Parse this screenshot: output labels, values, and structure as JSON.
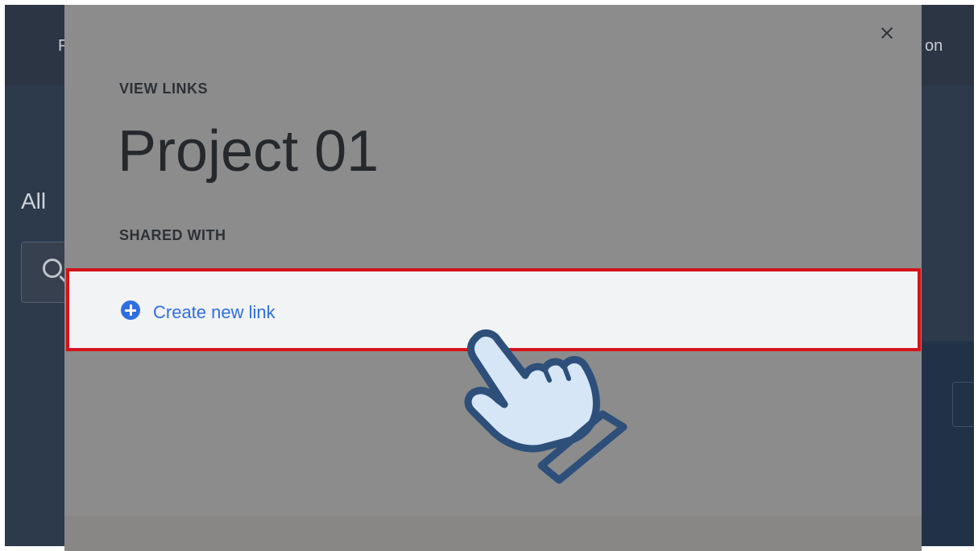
{
  "background": {
    "nav_left_text": "F",
    "nav_right_text": "on",
    "section_title": "All"
  },
  "modal": {
    "eyebrow": "VIEW LINKS",
    "title": "Project 01",
    "shared_with_label": "SHARED WITH",
    "create_link_label": "Create new link"
  },
  "icons": {
    "close": "close-icon",
    "plus": "plus-circle-icon",
    "search": "search-icon",
    "pointer": "hand-pointer-icon"
  },
  "colors": {
    "highlight_border": "#d4131b",
    "link_blue": "#2f6ee0",
    "modal_overlay": "#8c8c8c"
  }
}
